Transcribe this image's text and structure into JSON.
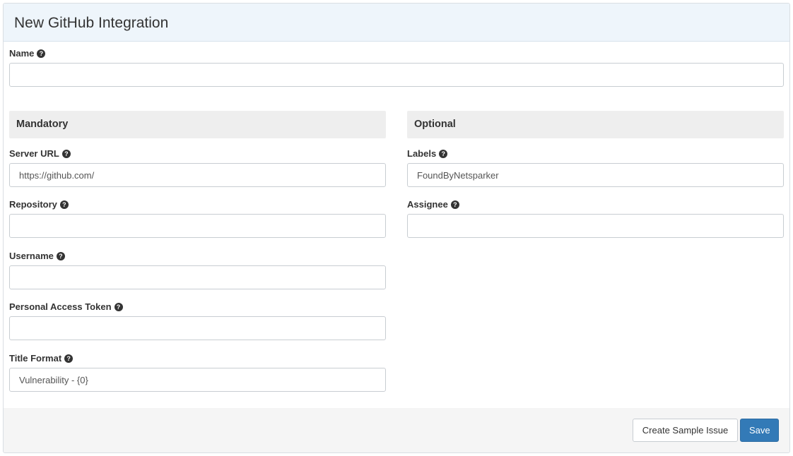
{
  "panel": {
    "title": "New GitHub Integration"
  },
  "help_icon_glyph": "?",
  "fields": {
    "name": {
      "label": "Name",
      "value": ""
    },
    "server_url": {
      "label": "Server URL",
      "value": "https://github.com/"
    },
    "repository": {
      "label": "Repository",
      "value": ""
    },
    "username": {
      "label": "Username",
      "value": ""
    },
    "personal_access_token": {
      "label": "Personal Access Token",
      "value": ""
    },
    "title_format": {
      "label": "Title Format",
      "value": "Vulnerability - {0}"
    },
    "labels": {
      "label": "Labels",
      "value": "FoundByNetsparker"
    },
    "assignee": {
      "label": "Assignee",
      "value": ""
    }
  },
  "sections": {
    "mandatory": "Mandatory",
    "optional": "Optional"
  },
  "footer": {
    "create_sample_issue_label": "Create Sample Issue",
    "save_label": "Save"
  },
  "colors": {
    "heading_background": "#eef5fb",
    "section_background": "#eeeeee",
    "footer_background": "#f5f5f5",
    "primary_button": "#337ab7"
  },
  "icons": {
    "help": "question-circle-icon"
  }
}
